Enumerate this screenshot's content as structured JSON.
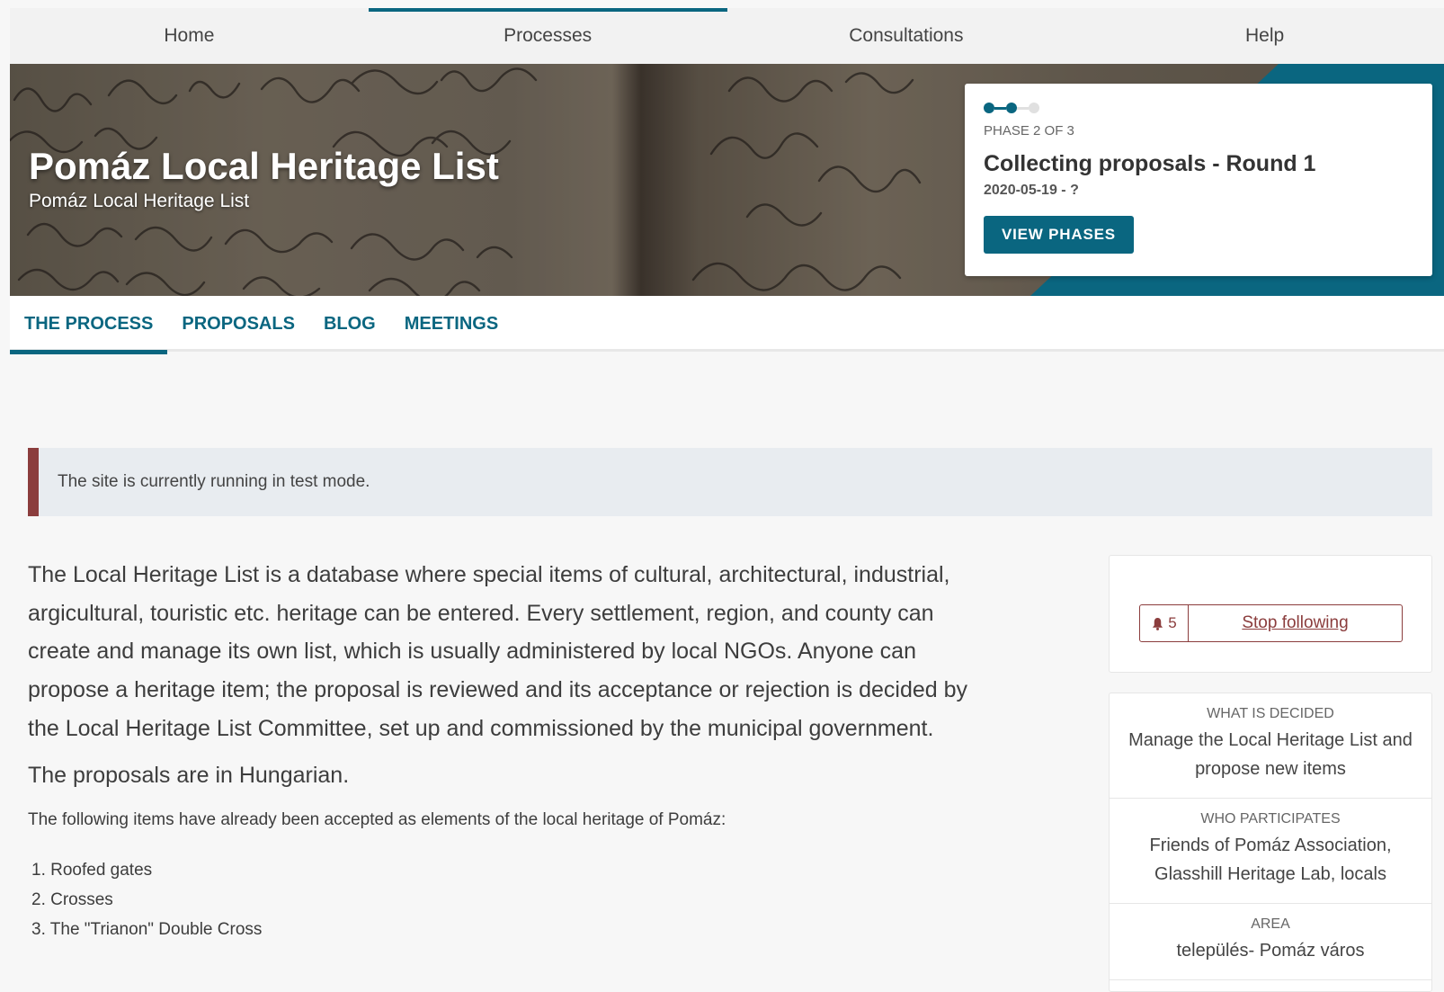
{
  "topnav": {
    "items": [
      {
        "label": "Home"
      },
      {
        "label": "Processes"
      },
      {
        "label": "Consultations"
      },
      {
        "label": "Help"
      }
    ],
    "active_index": 1
  },
  "hero": {
    "title": "Pomáz Local Heritage List",
    "subtitle": "Pomáz Local Heritage List"
  },
  "phase": {
    "label": "PHASE 2 OF 3",
    "current": 2,
    "total": 3,
    "title": "Collecting proposals - Round 1",
    "dates": "2020-05-19 - ?",
    "button_label": "VIEW PHASES"
  },
  "tabs": [
    {
      "label": "THE PROCESS"
    },
    {
      "label": "PROPOSALS"
    },
    {
      "label": "BLOG"
    },
    {
      "label": "MEETINGS"
    }
  ],
  "callout": {
    "text": "The site is currently running in test mode."
  },
  "description": {
    "main": "The Local Heritage List is a database where special items of cultural, architectural, industrial, argicultural, touristic etc. heritage can be entered. Every settlement, region, and county can create and manage its own list, which is usually administered by local NGOs. Anyone can propose a heritage item; the proposal is reviewed and its acceptance or rejection is decided by the Local Heritage List Committee, set up and commissioned by the municipal government.",
    "second": "The proposals are in Hungarian.",
    "small": "The following items have already been accepted as elements of the local heritage of Pomáz:",
    "accepted": [
      "1. Roofed gates",
      "2. Crosses",
      "3. The \"Trianon\" Double Cross"
    ]
  },
  "follow": {
    "count": "5",
    "label": "Stop following",
    "icon": "bell-icon"
  },
  "meta": {
    "decided_label": "WHAT IS DECIDED",
    "decided_value": "Manage the Local Heritage List and propose new items",
    "participants_label": "WHO PARTICIPATES",
    "participants_value": "Friends of Pomáz Association, Glasshill Heritage Lab, locals",
    "area_label": "AREA",
    "area_value": "település- Pomáz város"
  },
  "colors": {
    "primary": "#0a6680",
    "alert": "#8b3d3d",
    "background": "#f7f7f7"
  }
}
